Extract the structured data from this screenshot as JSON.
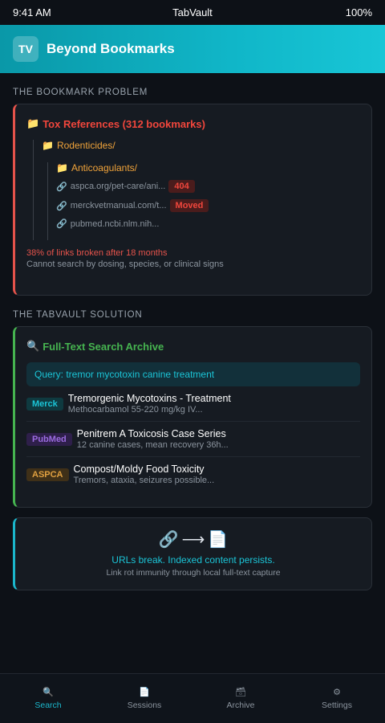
{
  "status": {
    "time": "9:41 AM",
    "app": "TabVault",
    "battery": "100%"
  },
  "header": {
    "logo": "TV",
    "title": "Beyond Bookmarks"
  },
  "problem": {
    "heading": "THE BOOKMARK PROBLEM",
    "root_folder": "Tox References (312 bookmarks)",
    "sub_folder": "Rodenticides/",
    "sub_sub_folder": "Anticoagulants/",
    "links": [
      {
        "url": "aspca.org/pet-care/ani...",
        "badge": "404"
      },
      {
        "url": "merckvetmanual.com/t...",
        "badge": "Moved"
      },
      {
        "url": "pubmed.ncbi.nlm.nih...",
        "badge": ""
      }
    ],
    "broken_text": "38% of links broken after 18 months",
    "sub_text": "Cannot search by dosing, species, or clinical signs"
  },
  "solution": {
    "heading": "THE TABVAULT SOLUTION",
    "title": "Full-Text Search Archive",
    "query": "Query: tremor mycotoxin canine treatment",
    "results": [
      {
        "source": "Merck",
        "title": "Tremorgenic Mycotoxins - Treatment",
        "snippet": "Methocarbamol 55-220 mg/kg IV..."
      },
      {
        "source": "PubMed",
        "title": "Penitrem A Toxicosis Case Series",
        "snippet": "12 canine cases, mean recovery 36h..."
      },
      {
        "source": "ASPCA",
        "title": "Compost/Moldy Food Toxicity",
        "snippet": "Tremors, ataxia, seizures possible..."
      }
    ]
  },
  "persist": {
    "icons": [
      "link-icon",
      "arrow-icon",
      "document-icon"
    ],
    "headline": "URLs break. Indexed content persists.",
    "sub": "Link rot immunity through local full-text capture"
  },
  "nav": {
    "items": [
      {
        "label": "Search",
        "icon": "search-icon",
        "active": true
      },
      {
        "label": "Sessions",
        "icon": "document-icon",
        "active": false
      },
      {
        "label": "Archive",
        "icon": "archive-icon",
        "active": false
      },
      {
        "label": "Settings",
        "icon": "gear-icon",
        "active": false
      }
    ]
  },
  "colors": {
    "accent": "#1bb7cc",
    "danger": "#e5534b",
    "success": "#46b450",
    "warning": "#f0a33a"
  }
}
